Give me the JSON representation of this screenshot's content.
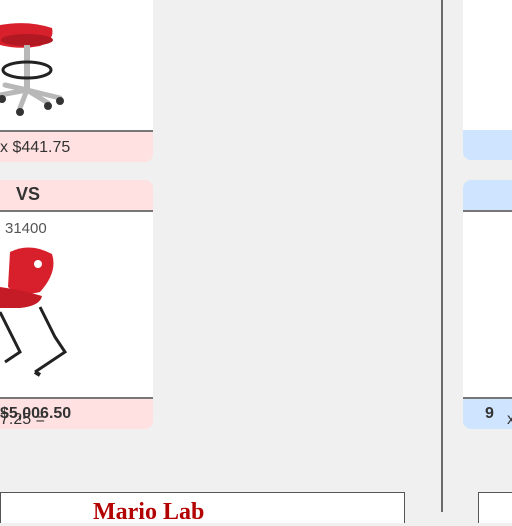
{
  "left_column": {
    "card1": {
      "price_line": "x $441.75",
      "image_icon": "stool-chair-icon"
    },
    "card2": {
      "header_label": "VS",
      "product_code": "31400",
      "price_prefix": "7.25 = ",
      "price_total": "$5,006.50",
      "image_icon": "sled-chair-icon"
    }
  },
  "right_column": {
    "card2": {
      "quantity": "9",
      "times": " x"
    }
  },
  "bottom": {
    "logo_text": "Mario Lab"
  },
  "colors": {
    "chair_red": "#d8202d",
    "pink_panel": "#ffe1e1",
    "blue_panel": "#cfe5ff",
    "divider": "#6b6b6b",
    "logo_red": "#b30000"
  }
}
